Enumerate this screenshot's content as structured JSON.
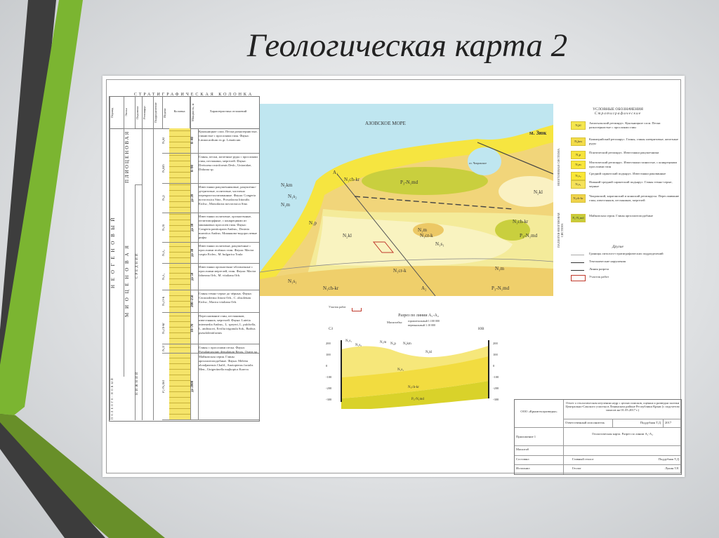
{
  "slide": {
    "title": "Геологическая карта 2"
  },
  "colors": {
    "green_light": "#7bb531",
    "green_dark": "#678f28",
    "gray_dark": "#3c3c3c",
    "sea": "#bfe6f0"
  },
  "strat_column": {
    "title": "СТРАТИГРАФИЧЕСКАЯ КОЛОНКА",
    "headers": [
      "Период",
      "Эпоха",
      "Подэпоха",
      "Региоярус",
      "Подразделение",
      "Индекс",
      "Колонка",
      "Мощность, м",
      "Характеристика отложений"
    ],
    "period": "Н Е О Г Е Н О В Ы Й",
    "epoch_pliocene": "ПЛИОЦЕНОВАЯ",
    "epoch_miocene": "М И О Ц Е Н О В А Я",
    "subepoch_middle": "СРЕДНИЙ",
    "subepoch_lower": "НИЖНИЙ",
    "paleogene": "ПАЛЕОГЕ-НОВЫЙ",
    "rows": [
      {
        "index": "N₂kl",
        "thickness": "8–40",
        "desc": "Куяльницкие слои. Пески разнозернистые, глинистые с прослоями глин. Фауна: Limnocardium ex gr. Lenaticum"
      },
      {
        "index": "N₂km",
        "thickness": "8–90",
        "desc": "Глины, пески, железные руды с прослоями глин, песчаники, мергелей. Фауна: Dreissena rostriformis Desh., Unionidae, Didacna sp."
      },
      {
        "index": "N₁p",
        "thickness": "до 20",
        "desc": "Известняки ракушечниковые, ракушечно-детритовые, оолитовые, частично перекристаллизованные. Фауна: Congeria novorossica Sinz., Prosodacna littoralis Eichw., Monodacna novorossica Sinz."
      },
      {
        "index": "N₁m",
        "thickness": "до 30",
        "desc": "Известняки оолитовые, органогенные, пелитоморфные, с конкрециями из мшанковых прослоев глин. Фауна: Congeria panticapaea Andrus., Dosinia maeotica Andrus. Мшанково-водорослевые рифы"
      },
      {
        "index": "N₁s₂",
        "thickness": "до 30",
        "desc": "Известняки оолитовые, ракушечные с прослоями зелёных глин. Фауна: Mactra caspia Eichw., M. bulgarica Toula"
      },
      {
        "index": "N₁s₁",
        "thickness": "до 50",
        "desc": "Известняки органогенно-обломочные с прослоями мергелей, глин. Фауна: Mactra fabreana Orb., M. vitaliana Orb."
      },
      {
        "index": "N₁cr-k",
        "thickness": "200–250",
        "desc": "Глины темно-серые до чёрных. Фауна: Cerastoderma fittoni Orb., C. obsoletum Eichw., Mactra vitaliana Orb."
      },
      {
        "index": "N₁ch-kr",
        "thickness": "10–70",
        "desc": "Переслаивание глин, песчаников, известняков, мергелей. Фауна: Lutetia intermedia Andrus., L. speyeri, L. pulchella, L. andrusovi, Ervilia trigonula Sok., Barbus pseudolentiformis"
      },
      {
        "index": "N₁tr",
        "thickness": "",
        "desc": "Глины с прослоями песка. Фауна: Pseudamussium denudatum Reuss, Ostrea sp."
      },
      {
        "index": "P₃-N₁md",
        "thickness": "до 2000",
        "desc": "Майкопская серия. Глины аргиллитоподобные. Фауна: Meletta alvadjanensis Chalil., Anotopterus facialis Men., Unigeriinella majkopica Kraeva"
      }
    ]
  },
  "map": {
    "sea_label": "АЗОВСКОЕ МОРЕ",
    "lake_label": "оз. Чокракское",
    "cape_label": "м. Зюк",
    "section_start": "A₁",
    "section_end": "A₂",
    "unit_labels": [
      "N₂km",
      "N₁s₂",
      "N₁ch-kr",
      "P₃-N₁md",
      "N₁m",
      "N₁s₁",
      "N₂kl",
      "N₁p",
      "N₁cr-k",
      "N₁m",
      "N₂kl",
      "N₁ch-kr",
      "P₃-N₁md",
      "N₁cr-k",
      "N₁m",
      "N₁s₁",
      "N₁ch-kr",
      "P₃-N₁md"
    ]
  },
  "legend": {
    "title": "УСЛОВНЫЕ ОБОЗНАЧЕНИЯ",
    "subtitle": "Стратиграфические",
    "system_neogene": "НЕОГЕНОВАЯ СИСТЕМА",
    "system_paleogene": "ПАЛЕОГЕН-НЕОГЕНОВАЯ СИСТЕМА",
    "items": [
      {
        "code": "N₂kl",
        "text": "Акчагыльский региоярус. Куяльницкие слои. Пески разнозернистые с прослоями глин"
      },
      {
        "code": "N₂km",
        "text": "Киммерийский региоярус. Глины, глины алевритовые, железные руды"
      },
      {
        "code": "N₁p",
        "text": "Понтический региоярус. Известняки ракушечники"
      },
      {
        "code": "N₁m",
        "text": "Мэотический региоярус. Известняки глинистые, с конкрециями прослоями глин"
      },
      {
        "code": "N₁s₂",
        "text": "Средний сарматский подъярус. Известняки раковинные"
      },
      {
        "code": "N₁s₁",
        "text": "Нижний-средний сарматский подъярус. Глины темно-серые, черные"
      },
      {
        "code": "N₁ch-kr",
        "text": "Чокракский, караганский и конкский региоярусы. Переслаивание глин, известняков, песчаников, мергелей"
      },
      {
        "code": "P₃-N₁md",
        "text": "Майкопская серия. Глины аргиллитоподобные"
      }
    ],
    "other_title": "Другие",
    "others": [
      "Границы литолого-стратиграфических подразделений",
      "Тектонические нарушения",
      "Линия разреза",
      "Участок работ"
    ]
  },
  "section": {
    "work_area": "Участок работ",
    "title": "Разрез по линии A₁-A₂",
    "scale_label": "Масштабы:",
    "scale_h": "горизонтальный 1:100 000",
    "scale_v": "вертикальный 1:10 000",
    "left_end": "СЗ",
    "right_end": "ЮВ",
    "ticks": [
      "200",
      "100",
      "0",
      "-100",
      "-200",
      "-300"
    ],
    "labels": [
      "N₁s₁",
      "N₁s₂",
      "N₁m",
      "N₁p",
      "N₂km",
      "N₂kl",
      "N₁s₁",
      "N₁ch-kr",
      "P₃-N₁md"
    ]
  },
  "stamp": {
    "org": "ООО «Крымгеолразведка»",
    "report": "Отчет о геологическом изучении недр с целью поисков, оценки и разведки залежи Центрально-Сакского участка в Ленинском районе Республики Крым (с подсчетом запасов на 01.05.2017 г.)",
    "responsible_label": "Ответственный исполнитель",
    "responsible": "Поддубная Т.Д.",
    "year": "2017",
    "appendix": "Приложение 1",
    "drawing": "Геологическая карта. Разрез по линии A₁-A₂",
    "scale": "Масштаб",
    "composed": "Составил",
    "composed_role": "Главный геолог",
    "composed_name": "Поддубная Т.Д.",
    "executed": "Исполнил",
    "executed_role": "Геолог",
    "executed_name": "Лукин Т.Е."
  }
}
